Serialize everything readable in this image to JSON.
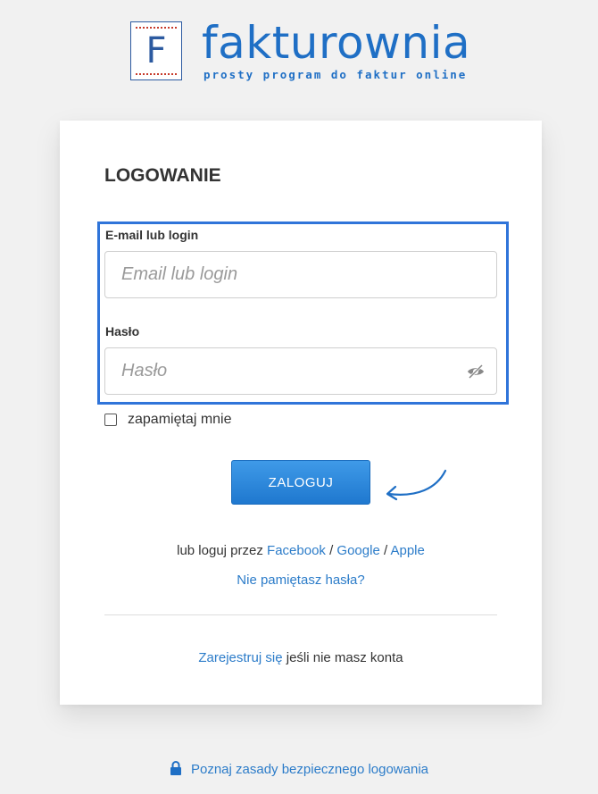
{
  "logo": {
    "letter": "F",
    "name": "fakturownia",
    "tagline": "prosty program do faktur online"
  },
  "form": {
    "title": "LOGOWANIE",
    "email_label": "E-mail lub login",
    "email_placeholder": "Email lub login",
    "email_value": "",
    "password_label": "Hasło",
    "password_placeholder": "Hasło",
    "password_value": "",
    "remember_label": "zapamiętaj mnie",
    "remember_checked": false,
    "submit_label": "ZALOGUJ"
  },
  "alt_login": {
    "prefix": "lub loguj przez",
    "facebook": "Facebook",
    "sep1": "/",
    "google": "Google",
    "sep2": "/",
    "apple": "Apple"
  },
  "forgot_password": "Nie pamiętasz hasła?",
  "register": {
    "link": "Zarejestruj się",
    "suffix": "jeśli nie masz konta"
  },
  "secure_info": "Poznaj zasady bezpiecznego logowania",
  "icons": {
    "eye": "eye-slash-icon",
    "lock": "lock-icon",
    "arrow": "curved-arrow-icon"
  },
  "colors": {
    "accent": "#1f78cf",
    "link": "#2c7cc9",
    "highlight": "#2f74d9",
    "background": "#f1f1f1"
  }
}
